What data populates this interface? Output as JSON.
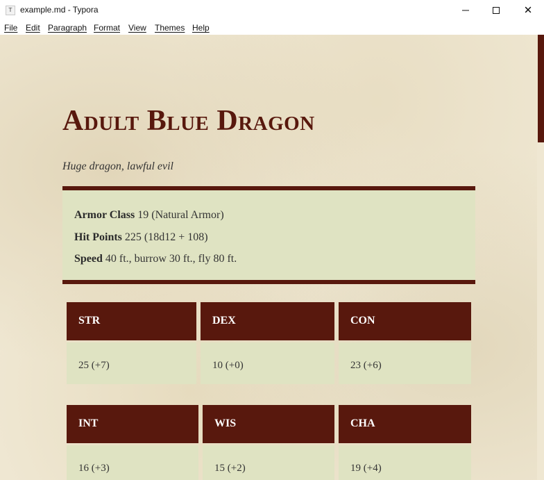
{
  "window": {
    "title": "example.md - Typora",
    "app_icon": "typora-icon",
    "app_icon_glyph": "T",
    "minimize_icon": "minimize-icon",
    "maximize_icon": "maximize-icon",
    "close_icon": "close-icon",
    "close_glyph": "✕"
  },
  "menu": {
    "items": [
      {
        "label": "File"
      },
      {
        "label": "Edit"
      },
      {
        "label": "Paragraph"
      },
      {
        "label": "Format"
      },
      {
        "label": "View"
      },
      {
        "label": "Themes"
      },
      {
        "label": "Help"
      }
    ]
  },
  "document": {
    "title": "Adult Blue Dragon",
    "subtitle": "Huge dragon, lawful evil",
    "stats": [
      {
        "label": "Armor Class",
        "value": "19 (Natural Armor)"
      },
      {
        "label": "Hit Points",
        "value": "225 (18d12 + 108)"
      },
      {
        "label": "Speed",
        "value": "40 ft., burrow 30 ft., fly 80 ft."
      }
    ],
    "abilities_row1": [
      {
        "label": "STR",
        "value": "25 (+7)"
      },
      {
        "label": "DEX",
        "value": "10 (+0)"
      },
      {
        "label": "CON",
        "value": "23 (+6)"
      }
    ],
    "abilities_row2": [
      {
        "label": "INT",
        "value": "16 (+3)"
      },
      {
        "label": "WIS",
        "value": "15 (+2)"
      },
      {
        "label": "CHA",
        "value": "19 (+4)"
      }
    ]
  },
  "colors": {
    "accent": "#58180d",
    "panel": "#dfe3c2",
    "parchment": "#efe7d2"
  }
}
